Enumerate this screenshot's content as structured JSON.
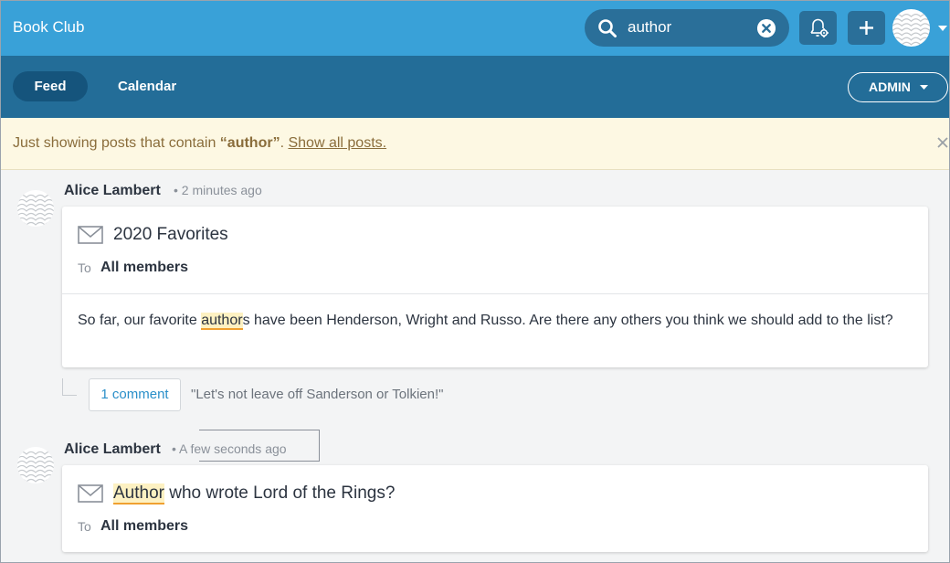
{
  "app": {
    "title": "Book Club"
  },
  "search": {
    "value": "author",
    "placeholder": ""
  },
  "nav": {
    "tabs": [
      "Feed",
      "Calendar"
    ],
    "admin_label": "ADMIN"
  },
  "banner": {
    "prefix": "Just showing posts that contain ",
    "term": "“author”",
    "period": ". ",
    "link": "Show all posts."
  },
  "posts": [
    {
      "author": "Alice Lambert",
      "time": "2 minutes ago",
      "subject": "2020 Favorites",
      "to_label": "To",
      "to_value": "All members",
      "body_before": "So far, our favorite ",
      "body_highlight": "author",
      "body_after": "s have been Henderson, Wright and Russo. Are there any others you think we should add to the list?",
      "comments_label": "1 comment",
      "comment_preview": "\"Let's not leave off Sanderson or Tolkien!\""
    },
    {
      "author": "Alice Lambert",
      "time": "A few seconds ago",
      "subject_highlight": "Author",
      "subject_rest": " who wrote Lord of the Rings?",
      "to_label": "To",
      "to_value": "All members"
    }
  ],
  "colors": {
    "topbar": "#39a1d8",
    "navbar": "#236d98",
    "banner_bg": "#fdf8e3",
    "highlight": "#f0a030"
  },
  "icons": [
    "search-icon",
    "clear-search-icon",
    "notification-settings-icon",
    "plus-icon",
    "user-avatar",
    "chevron-down-icon",
    "close-icon",
    "envelope-icon"
  ]
}
